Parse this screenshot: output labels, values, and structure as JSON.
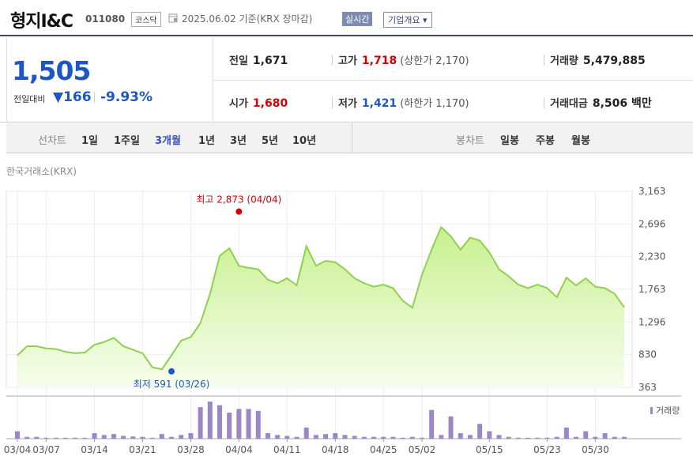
{
  "header": {
    "name": "형지I&C",
    "code": "011080",
    "market": "코스닥",
    "date": "2025.06.02 기준(KRX 장마감)",
    "realtime_label": "실시간",
    "company_button": "기업개요 ▾"
  },
  "quote": {
    "price": "1,505",
    "change_label": "전일대비",
    "change": "▼166",
    "change_pct": "-9.93%",
    "prev_label": "전일",
    "prev": "1,671",
    "high_label": "고가",
    "high": "1,718",
    "high_sub": "(상한가 2,170)",
    "volume_label": "거래량",
    "volume": "5,479,885",
    "open_label": "시가",
    "open": "1,680",
    "low_label": "저가",
    "low": "1,421",
    "low_sub": "(하한가 1,170)",
    "amount_label": "거래대금",
    "amount": "8,506 백만"
  },
  "toolbar": {
    "line_label": "선차트",
    "periods": [
      "1일",
      "1주일",
      "3개월",
      "1년",
      "3년",
      "5년",
      "10년"
    ],
    "active_period": "3개월",
    "candle_label": "봉차트",
    "candles": [
      "일봉",
      "주봉",
      "월봉"
    ]
  },
  "exchange_label": "한국거래소(KRX)",
  "colors": {
    "line": "#8fd14f",
    "fill_top": "#c8f08e",
    "fill_bottom": "#f6fdee",
    "volume": "#9b87c6",
    "down": "#1f56c5",
    "up": "#d60000"
  },
  "chart_data": {
    "type": "area",
    "y_ticks": [
      "3,163",
      "2,696",
      "2,230",
      "1,763",
      "1,296",
      "830",
      "363"
    ],
    "ylim": [
      363,
      3163
    ],
    "x_ticks": [
      "03/04",
      "03/07",
      "03/14",
      "03/21",
      "03/28",
      "04/04",
      "04/11",
      "04/18",
      "04/25",
      "05/02",
      "05/15",
      "05/23",
      "05/30"
    ],
    "x": [
      "03/04",
      "03/05",
      "03/06",
      "03/07",
      "03/10",
      "03/11",
      "03/12",
      "03/13",
      "03/14",
      "03/17",
      "03/18",
      "03/19",
      "03/20",
      "03/21",
      "03/24",
      "03/25",
      "03/26",
      "03/27",
      "03/28",
      "03/31",
      "04/01",
      "04/02",
      "04/03",
      "04/04",
      "04/07",
      "04/08",
      "04/09",
      "04/10",
      "04/11",
      "04/14",
      "04/15",
      "04/16",
      "04/17",
      "04/18",
      "04/21",
      "04/22",
      "04/23",
      "04/24",
      "04/25",
      "04/28",
      "04/29",
      "04/30",
      "05/02",
      "05/07",
      "05/08",
      "05/09",
      "05/12",
      "05/13",
      "05/14",
      "05/15",
      "05/16",
      "05/19",
      "05/20",
      "05/21",
      "05/22",
      "05/23",
      "05/26",
      "05/27",
      "05/28",
      "05/29",
      "05/30",
      "06/02"
    ],
    "values": [
      820,
      950,
      950,
      920,
      910,
      870,
      850,
      860,
      970,
      1010,
      1070,
      950,
      900,
      850,
      650,
      620,
      820,
      1030,
      1080,
      1280,
      1700,
      2240,
      2350,
      2100,
      2070,
      2050,
      1900,
      1850,
      1920,
      1820,
      2380,
      2100,
      2170,
      2150,
      2050,
      1920,
      1850,
      1800,
      1830,
      1780,
      1600,
      1500,
      1970,
      2330,
      2650,
      2520,
      2330,
      2500,
      2460,
      2290,
      2050,
      1950,
      1830,
      1780,
      1830,
      1780,
      1650,
      1930,
      1820,
      1920,
      1800,
      1780,
      1700,
      1505
    ],
    "volume": [
      0.4,
      0.1,
      0.1,
      0.05,
      0.05,
      0.05,
      0.05,
      0.05,
      0.3,
      0.2,
      0.25,
      0.15,
      0.12,
      0.1,
      0.05,
      0.25,
      0.1,
      0.2,
      0.3,
      1.7,
      2.0,
      1.8,
      1.4,
      1.6,
      1.6,
      1.5,
      0.3,
      0.2,
      0.15,
      0.1,
      0.6,
      0.2,
      0.25,
      0.3,
      0.2,
      0.15,
      0.1,
      0.1,
      0.1,
      0.1,
      0.05,
      0.1,
      0.05,
      1.55,
      0.2,
      1.2,
      0.3,
      0.2,
      0.8,
      0.4,
      0.2,
      0.1,
      0.05,
      0.05,
      0.05,
      0.05,
      0.1,
      0.6,
      0.1,
      0.4,
      0.1,
      0.3,
      0.1,
      0.1
    ],
    "max_label": "최고 2,873 (04/04)",
    "max_value": 2873,
    "max_date": "04/04",
    "min_label": "최저 591 (03/26)",
    "min_value": 591,
    "min_date": "03/26",
    "volume_legend": "거래량",
    "grid": true
  }
}
